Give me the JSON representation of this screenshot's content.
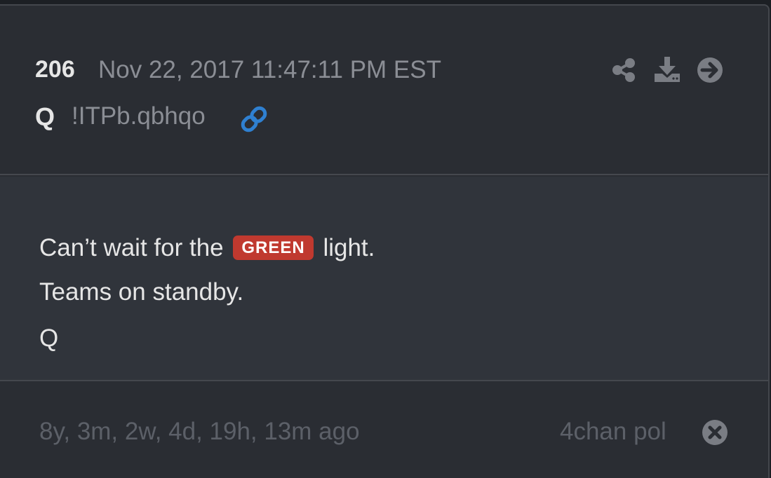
{
  "header": {
    "post_number": "206",
    "timestamp": "Nov 22, 2017 11:47:11 PM EST",
    "author": "Q",
    "tripcode": "!ITPb.qbhqo"
  },
  "icons": {
    "share": "share-icon",
    "download": "download-icon",
    "next": "arrow-right-circle-icon",
    "link": "link-icon",
    "close": "close-circle-icon"
  },
  "post": {
    "line1_before": "Can’t wait for the",
    "line1_badge": "GREEN",
    "line1_after": "light.",
    "line2": "Teams on standby.",
    "line3": "Q"
  },
  "footer": {
    "time_ago": "8y, 3m, 2w, 4d, 19h, 13m ago",
    "source": "4chan pol"
  },
  "colors": {
    "background": "#2a2d33",
    "body_background": "#30343b",
    "badge": "#c0392f",
    "link_icon": "#2f80d1"
  }
}
